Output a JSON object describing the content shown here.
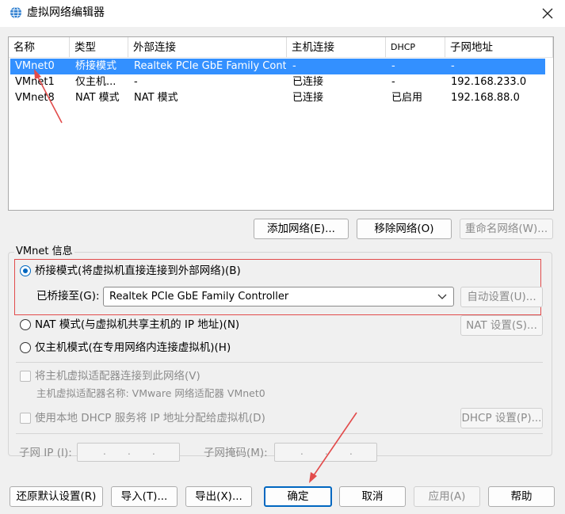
{
  "window": {
    "title": "虚拟网络编辑器",
    "icon": "globe-network-icon",
    "close_icon": "close-icon"
  },
  "network_table": {
    "columns": [
      "名称",
      "类型",
      "外部连接",
      "主机连接",
      "DHCP",
      "子网地址"
    ],
    "rows": [
      {
        "name": "VMnet0",
        "type": "桥接模式",
        "external": "Realtek PCIe GbE Family Contr...",
        "host": "-",
        "dhcp": "-",
        "subnet": "-",
        "selected": true
      },
      {
        "name": "VMnet1",
        "type": "仅主机...",
        "external": "-",
        "host": "已连接",
        "dhcp": "-",
        "subnet": "192.168.233.0",
        "selected": false
      },
      {
        "name": "VMnet8",
        "type": "NAT 模式",
        "external": "NAT 模式",
        "host": "已连接",
        "dhcp": "已启用",
        "subnet": "192.168.88.0",
        "selected": false
      }
    ]
  },
  "table_buttons": {
    "add": "添加网络(E)...",
    "remove": "移除网络(O)",
    "rename": "重命名网络(W)..."
  },
  "vmnet_info": {
    "legend": "VMnet 信息",
    "bridged": {
      "label": "桥接模式(将虚拟机直接连接到外部网络)(B)",
      "selected": true
    },
    "bridged_to_label": "已桥接至(G):",
    "bridged_to_value": "Realtek PCIe GbE Family Controller",
    "auto_settings": "自动设置(U)...",
    "nat": {
      "label": "NAT 模式(与虚拟机共享主机的 IP 地址)(N)",
      "selected": false
    },
    "nat_settings": "NAT 设置(S)...",
    "host_only": {
      "label": "仅主机模式(在专用网络内连接虚拟机)(H)",
      "selected": false
    },
    "connect_adapter": "将主机虚拟适配器连接到此网络(V)",
    "adapter_name": "主机虚拟适配器名称: VMware 网络适配器 VMnet0",
    "use_dhcp": "使用本地 DHCP 服务将 IP 地址分配给虚拟机(D)",
    "dhcp_settings": "DHCP 设置(P)...",
    "subnet_ip_label": "子网 IP (I):",
    "subnet_mask_label": "子网掩码(M):",
    "ip_dot": "."
  },
  "bottom_buttons": {
    "restore": "还原默认设置(R)",
    "import": "导入(T)...",
    "export": "导出(X)...",
    "ok": "确定",
    "cancel": "取消",
    "apply": "应用(A)",
    "help": "帮助"
  },
  "colors": {
    "selection": "#3390ff",
    "highlight_box": "#e24b4b",
    "arrow": "#e24b4b",
    "accent": "#0067c0"
  }
}
